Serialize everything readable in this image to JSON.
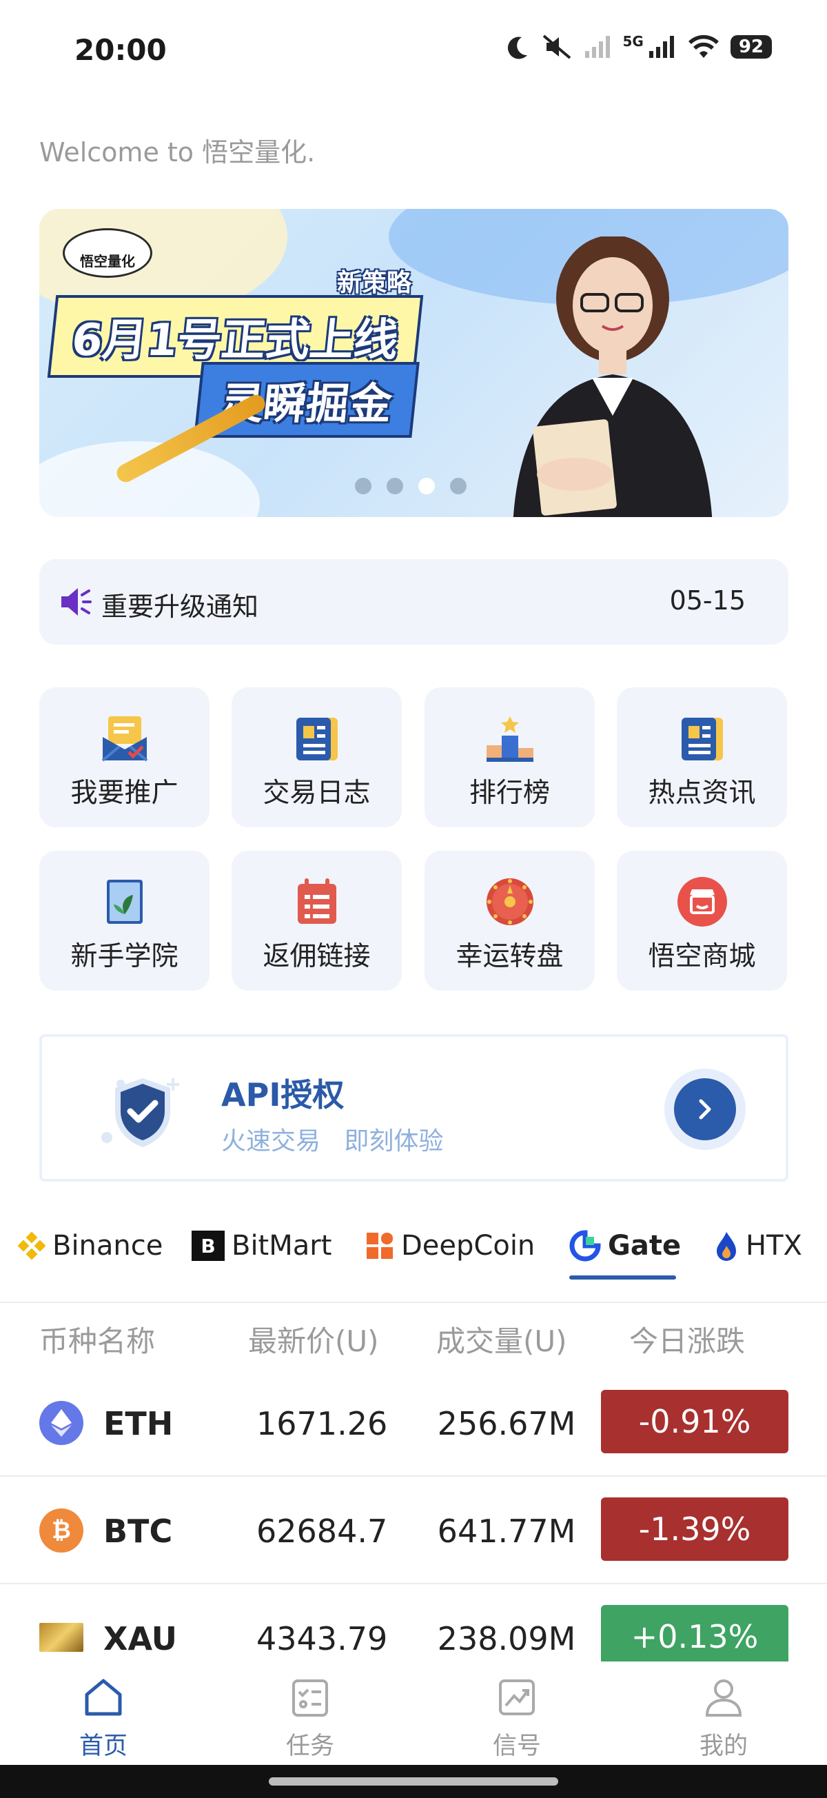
{
  "status_bar": {
    "time": "20:00",
    "network": "5G",
    "battery": "92"
  },
  "welcome_text": "Welcome to 悟空量化.",
  "banner": {
    "logo_text": "悟空量化",
    "subtitle": "新策略",
    "title_line1": "6月1号正式上线",
    "title_line2": "灵瞬掘金",
    "slide_count": 4,
    "active_slide": 3
  },
  "notice": {
    "icon": "speaker-icon",
    "text": "重要升级通知",
    "date": "05-15"
  },
  "grid": {
    "items": [
      {
        "label": "我要推广",
        "icon": "promotion-envelope-icon"
      },
      {
        "label": "交易日志",
        "icon": "journal-icon"
      },
      {
        "label": "排行榜",
        "icon": "leaderboard-icon"
      },
      {
        "label": "热点资讯",
        "icon": "news-icon"
      },
      {
        "label": "新手学院",
        "icon": "book-icon"
      },
      {
        "label": "返佣链接",
        "icon": "calendar-list-icon"
      },
      {
        "label": "幸运转盘",
        "icon": "lucky-wheel-icon"
      },
      {
        "label": "悟空商城",
        "icon": "shop-icon"
      }
    ]
  },
  "api_card": {
    "title": "API授权",
    "subtitle": "火速交易   即刻体验"
  },
  "exchanges": {
    "tabs": [
      "Binance",
      "BitMart",
      "DeepCoin",
      "Gate",
      "HTX"
    ],
    "active": "Gate"
  },
  "table": {
    "headers": [
      "币种名称",
      "最新价(U)",
      "成交量(U)",
      "今日涨跌"
    ],
    "rows": [
      {
        "coin": "ETH",
        "price": "1671.26",
        "volume": "256.67M",
        "change": "-0.91%"
      },
      {
        "coin": "BTC",
        "price": "62684.7",
        "volume": "641.77M",
        "change": "-1.39%"
      },
      {
        "coin": "XAU",
        "price": "4343.79",
        "volume": "238.09M",
        "change": "+0.13%"
      }
    ]
  },
  "colors": {
    "accent": "#2b5bab",
    "down": "#a8302f",
    "up": "#3ea363",
    "tile_bg": "#f1f4fb"
  },
  "bottom_nav": {
    "items": [
      {
        "label": "首页",
        "icon": "home-icon"
      },
      {
        "label": "任务",
        "icon": "task-icon"
      },
      {
        "label": "信号",
        "icon": "signal-chart-icon"
      },
      {
        "label": "我的",
        "icon": "profile-icon"
      }
    ],
    "active": "首页"
  }
}
